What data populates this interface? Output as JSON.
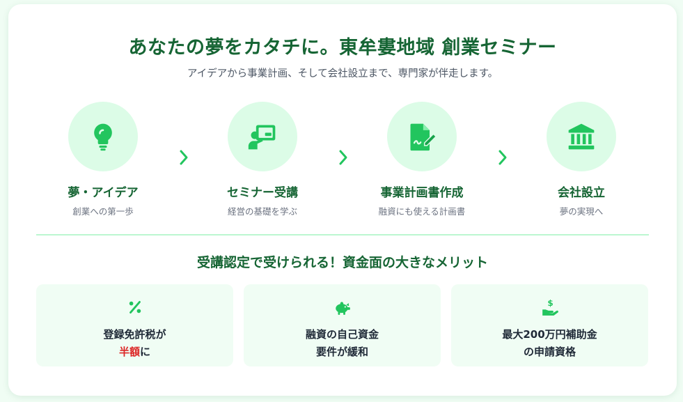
{
  "header": {
    "title": "あなたの夢をカタチに。東牟婁地域 創業セミナー",
    "subtitle": "アイデアから事業計画、そして会社設立まで、専門家が伴走します。"
  },
  "steps": [
    {
      "icon": "lightbulb-icon",
      "title": "夢・アイデア",
      "desc": "創業への第一歩"
    },
    {
      "icon": "teacher-board-icon",
      "title": "セミナー受講",
      "desc": "経営の基礎を学ぶ"
    },
    {
      "icon": "document-pen-icon",
      "title": "事業計画書作成",
      "desc": "融資にも使える計画書"
    },
    {
      "icon": "bank-building-icon",
      "title": "会社設立",
      "desc": "夢の実現へ"
    }
  ],
  "benefits": {
    "title": "受講認定で受けられる！資金面の大きなメリット",
    "items": [
      {
        "icon": "percent-icon",
        "line1": "登録免許税が",
        "line2_highlight": "半額",
        "line2_rest": "に"
      },
      {
        "icon": "piggy-bank-icon",
        "line1": "融資の自己資金",
        "line2": "要件が緩和"
      },
      {
        "icon": "hand-coin-icon",
        "line1": "最大200万円補助金",
        "line2": "の申請資格"
      }
    ]
  },
  "colors": {
    "accent": "#22c55e",
    "heading": "#166534",
    "circle_bg": "#dcfce7",
    "highlight": "#dc2626"
  }
}
